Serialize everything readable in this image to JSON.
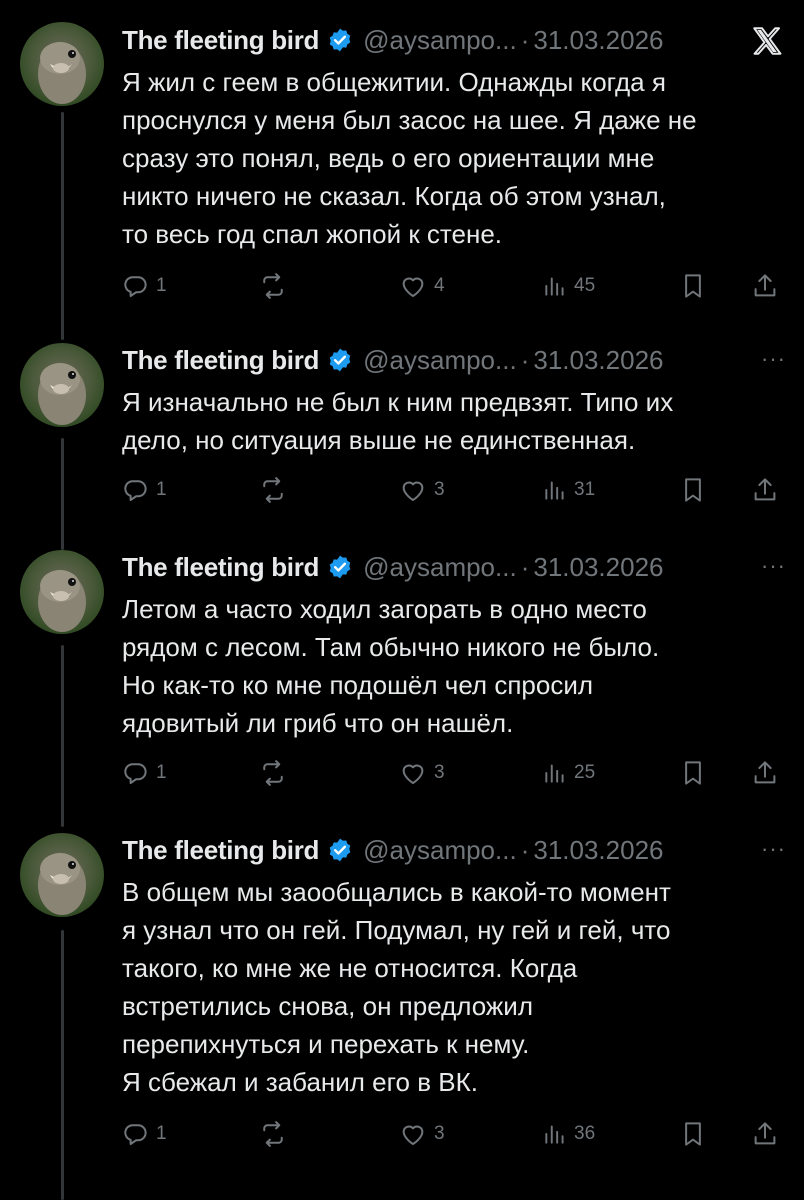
{
  "colors": {
    "background": "#000000",
    "text": "#e7e9ea",
    "muted": "#71767b",
    "verified": "#1d9bf0",
    "thread_line": "#333639"
  },
  "icons": {
    "verified": "verified-badge-icon",
    "x_logo": "x-logo-icon",
    "more": "more-icon",
    "reply": "reply-icon",
    "repost": "repost-icon",
    "like": "like-icon",
    "views": "views-icon",
    "bookmark": "bookmark-icon",
    "share": "share-icon"
  },
  "tweets": [
    {
      "name": "The fleeting bird",
      "handle": "@aysampo...",
      "separator": "·",
      "date": "31.03.2026",
      "text": "Я жил с геем в общежитии. Однажды когда я\nпроснулся у меня был засос на шее. Я даже не\nсразу это понял, ведь о его ориентации мне\nникто ничего не сказал. Когда об этом узнал,\nто весь год спал жопой к стене.",
      "replies": "1",
      "likes": "4",
      "views": "45",
      "top_right": "x-logo",
      "more_label": ""
    },
    {
      "name": "The fleeting bird",
      "handle": "@aysampo...",
      "separator": "·",
      "date": "31.03.2026",
      "text": "Я изначально не был к ним предвзят. Типо их\nдело, но ситуация выше не единственная.",
      "replies": "1",
      "likes": "3",
      "views": "31",
      "top_right": "more",
      "more_label": "···"
    },
    {
      "name": "The fleeting bird",
      "handle": "@aysampo...",
      "separator": "·",
      "date": "31.03.2026",
      "text": "Летом а часто ходил загорать в одно место\nрядом с лесом. Там обычно никого не было.\nНо как-то ко мне подошёл чел спросил\nядовитый ли гриб что он нашёл.",
      "replies": "1",
      "likes": "3",
      "views": "25",
      "top_right": "more",
      "more_label": "···"
    },
    {
      "name": "The fleeting bird",
      "handle": "@aysampo...",
      "separator": "·",
      "date": "31.03.2026",
      "text": "В общем мы заообщались в какой-то момент\nя узнал что он гей. Подумал, ну гей и гей, что\nтакого, ко мне же не относится. Когда\nвстретились снова, он предложил\nперепихнуться и перехать к нему.\nЯ сбежал и забанил его в ВК.",
      "replies": "1",
      "likes": "3",
      "views": "36",
      "top_right": "more",
      "more_label": "···"
    }
  ]
}
